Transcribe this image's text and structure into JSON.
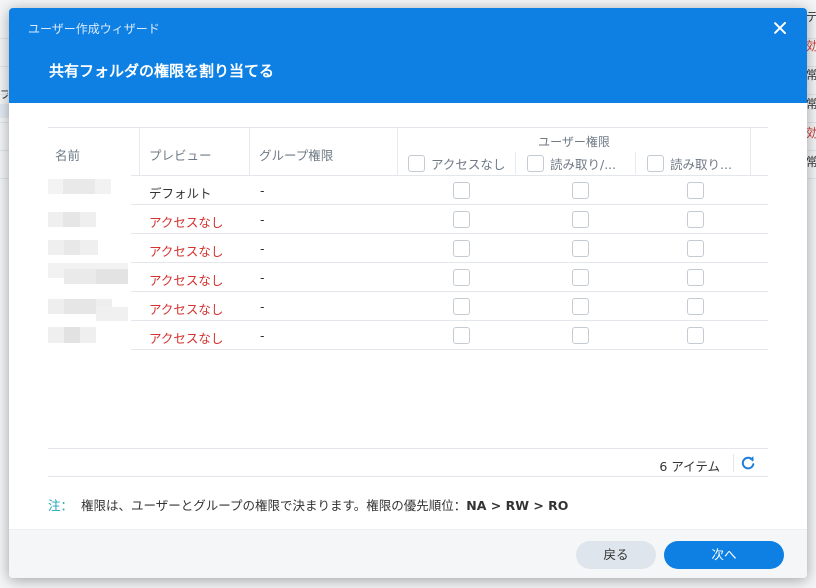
{
  "background": {
    "left_items": [
      "プ"
    ],
    "right_items": [
      {
        "text": "テ",
        "color": "#333333"
      },
      {
        "text": "効",
        "color": "#d4332f"
      },
      {
        "text": "常",
        "color": "#333333"
      },
      {
        "text": "常",
        "color": "#333333"
      },
      {
        "text": "効",
        "color": "#d4332f"
      },
      {
        "text": "常",
        "color": "#333333"
      }
    ]
  },
  "dialog": {
    "wizard_title": "ユーザー作成ウィザード",
    "close_icon": "close-icon",
    "step_title": "共有フォルダの権限を割り当てる"
  },
  "grid": {
    "headers": {
      "name": "名前",
      "preview": "プレビュー",
      "group_permission": "グループ権限",
      "user_permission": "ユーザー権限",
      "user_cols": [
        "アクセスなし",
        "読み取り/...",
        "読み取り..."
      ]
    },
    "rows": [
      {
        "name": "",
        "preview": "デフォルト",
        "preview_status": "default",
        "group_permission": "-",
        "no_access": false,
        "read_write": false,
        "read_only": false
      },
      {
        "name": "",
        "preview": "アクセスなし",
        "preview_status": "denied",
        "group_permission": "-",
        "no_access": false,
        "read_write": false,
        "read_only": false
      },
      {
        "name": "",
        "preview": "アクセスなし",
        "preview_status": "denied",
        "group_permission": "-",
        "no_access": false,
        "read_write": false,
        "read_only": false
      },
      {
        "name": "",
        "preview": "アクセスなし",
        "preview_status": "denied",
        "group_permission": "-",
        "no_access": false,
        "read_write": false,
        "read_only": false
      },
      {
        "name": "",
        "preview": "アクセスなし",
        "preview_status": "denied",
        "group_permission": "-",
        "no_access": false,
        "read_write": false,
        "read_only": false
      },
      {
        "name": "",
        "preview": "アクセスなし",
        "preview_status": "denied",
        "group_permission": "-",
        "no_access": false,
        "read_write": false,
        "read_only": false
      }
    ],
    "item_count": "6 アイテム",
    "refresh_icon": "refresh-icon"
  },
  "note": {
    "label": "注：",
    "text": "権限は、ユーザーとグループの権限で決まります。権限の優先順位：",
    "priority": "NA > RW > RO"
  },
  "buttons": {
    "back": "戻る",
    "next": "次へ"
  },
  "colors": {
    "accent": "#0e80e3",
    "denied_text": "#d4332f",
    "note_label": "#1ea5b9"
  }
}
